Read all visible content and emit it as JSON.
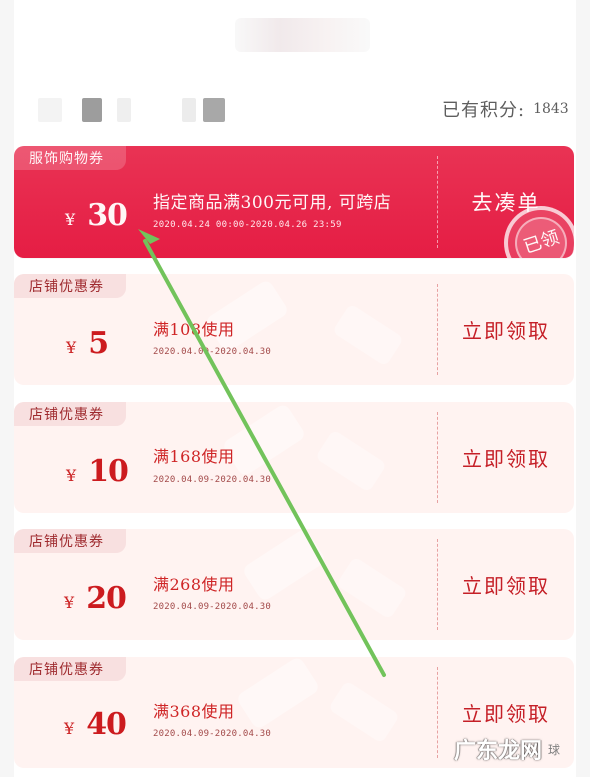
{
  "points": {
    "label": "已有积分:",
    "value": "1843"
  },
  "coupons": [
    {
      "badge": "服饰购物券",
      "currency": "¥",
      "amount": "30",
      "condition": "指定商品满300元可用, 可跨店",
      "date": "2020.04.24 00:00-2020.04.26 23:59",
      "action": "去凑单",
      "stamp": "已领"
    },
    {
      "badge": "店铺优惠券",
      "currency": "¥",
      "amount": "5",
      "condition": "满108使用",
      "date": "2020.04.09-2020.04.30",
      "action": "立即领取"
    },
    {
      "badge": "店铺优惠券",
      "currency": "¥",
      "amount": "10",
      "condition": "满168使用",
      "date": "2020.04.09-2020.04.30",
      "action": "立即领取"
    },
    {
      "badge": "店铺优惠券",
      "currency": "¥",
      "amount": "20",
      "condition": "满268使用",
      "date": "2020.04.09-2020.04.30",
      "action": "立即领取"
    },
    {
      "badge": "店铺优惠券",
      "currency": "¥",
      "amount": "40",
      "condition": "满368使用",
      "date": "2020.04.09-2020.04.30",
      "action": "立即领取"
    }
  ],
  "watermark": {
    "text": "广东龙网",
    "tail": "球"
  },
  "colors": {
    "accent_red": "#e51d44",
    "coupon_text_red": "#cc1b1f",
    "arrow_green": "#72c35b"
  }
}
